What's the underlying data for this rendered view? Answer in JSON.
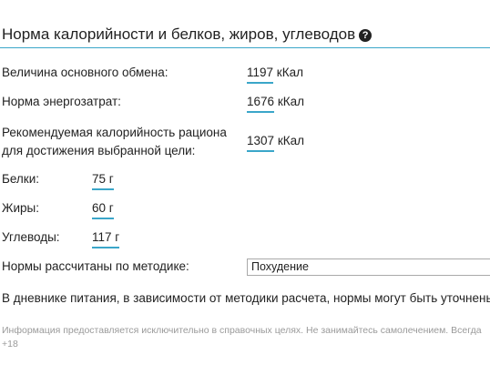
{
  "section": {
    "title": "Норма калорийности и белков, жиров, углеводов",
    "help_icon_glyph": "?",
    "accent_color": "#3aa6c9"
  },
  "metrics": {
    "bmr_label": "Величина основного обмена:",
    "bmr_value": "1197",
    "energy_label": "Норма энергозатрат:",
    "energy_value": "1676",
    "recommended_label_line1": "Рекомендуемая калорийность рациона",
    "recommended_label_line2": "для достижения выбранной цели:",
    "recommended_value": "1307",
    "unit": "кКал"
  },
  "macros": {
    "protein_label": "Белки:",
    "protein_value": "75",
    "fat_label": "Жиры:",
    "fat_value": "60",
    "carbs_label": "Углеводы:",
    "carbs_value": "117",
    "unit": "г"
  },
  "method": {
    "label": "Нормы рассчитаны по методике:",
    "selected": "Похудение"
  },
  "note": "В дневнике питания, в зависимости от методики расчета, нормы могут быть уточнены",
  "disclaimer": {
    "line1": "Информация предоставляется исключительно в справочных целях. Не занимайтесь самолечением. Всегда",
    "line2": "+18"
  }
}
